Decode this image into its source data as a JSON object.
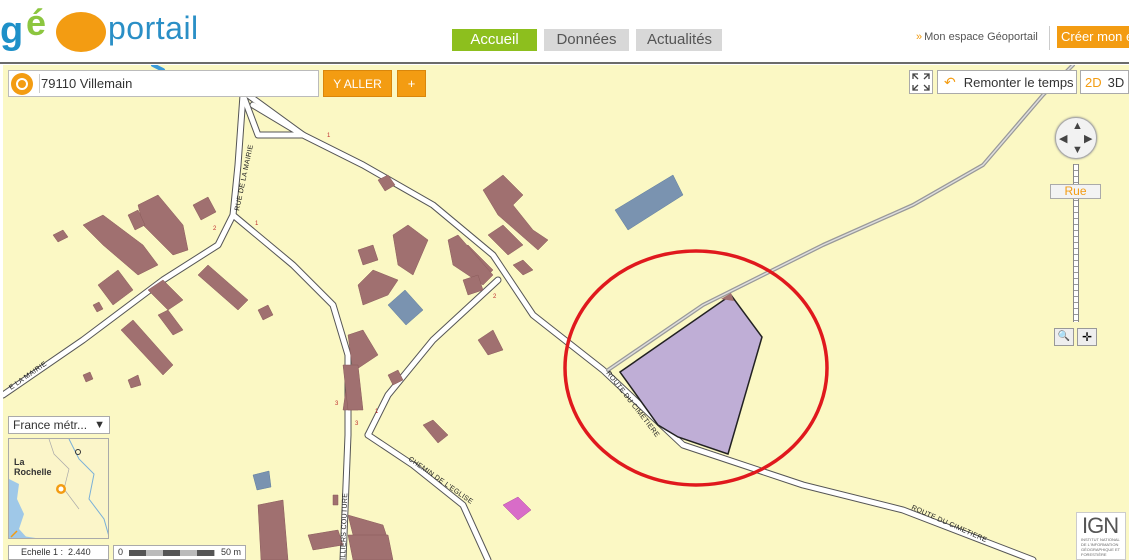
{
  "header": {
    "logo_prefix": "géo",
    "logo_suffix": "portail",
    "nav": [
      {
        "label": "Accueil",
        "active": true
      },
      {
        "label": "Données",
        "active": false
      },
      {
        "label": "Actualités",
        "active": false
      }
    ],
    "espace_label": "Mon espace Géoportail",
    "create_label": "Créer mon e"
  },
  "search": {
    "value": "79110 Villemain",
    "go_label": "Y ALLER",
    "plus_label": "+"
  },
  "map_tools": {
    "remonter_label": "Remonter le temps",
    "mode_2d": "2D",
    "mode_3d": "3D",
    "zoom_level_label": "Rue"
  },
  "street_labels": {
    "rue_mairie_1": "RUE DE LA MAIRIE",
    "rue_mairie_2": "E LA MAIRIE",
    "route_cimetiere_1": "ROUTE DU CIMETIERE",
    "route_cimetiere_2": "ROUTE DU CIMETIERE",
    "chemin_eglise": "CHEMIN DE L'EGLISE",
    "rue_couture": "ILLIERS COUTURE"
  },
  "overview": {
    "territory": "France métr...",
    "city_label": "La Rochelle"
  },
  "scale": {
    "ratio_label": "Echelle 1 :",
    "ratio_value": "2.440",
    "bar_start": "0",
    "bar_end": "50 m"
  },
  "ign": {
    "big": "IGN",
    "small": "INSTITUT NATIONAL DE L'INFORMATION GÉOGRAPHIQUE ET FORESTIÈRE"
  },
  "colors": {
    "accent": "#f39c12",
    "nav_active": "#8dbf1e",
    "map_bg": "#fbf8c4",
    "building": "#a07070",
    "highlight_parcel": "#bfaed6",
    "circle": "#e0191d"
  }
}
